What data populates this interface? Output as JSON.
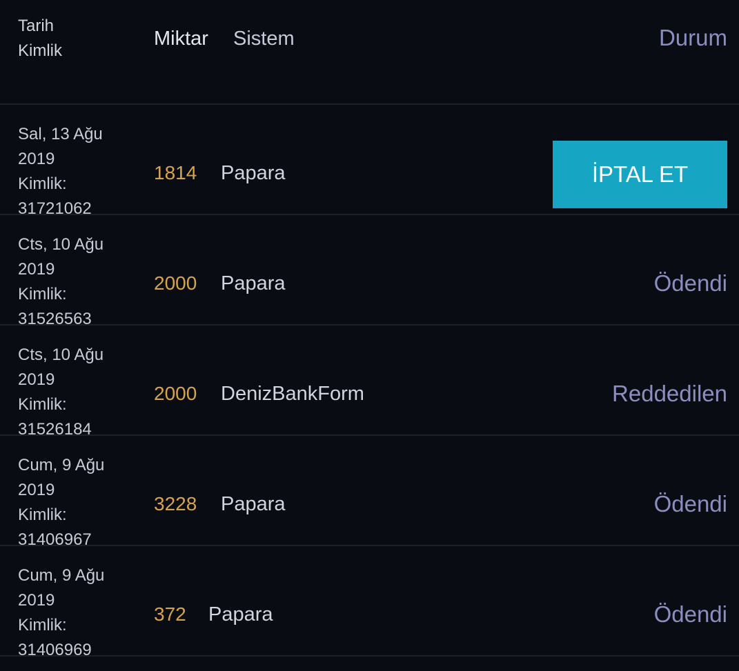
{
  "header": {
    "date_label": "Tarih",
    "id_label": "Kimlik",
    "amount_label": "Miktar",
    "system_label": "Sistem",
    "status_label": "Durum"
  },
  "rows": [
    {
      "date_line1": "Sal, 13 Ağu",
      "date_line2": "2019",
      "id_label": "Kimlik:",
      "id": "31721062",
      "amount": "1814",
      "system": "Papara",
      "action": "İPTAL ET"
    },
    {
      "date_line1": "Cts, 10 Ağu",
      "date_line2": "2019",
      "id_label": "Kimlik:",
      "id": "31526563",
      "amount": "2000",
      "system": "Papara",
      "status": "Ödendi"
    },
    {
      "date_line1": "Cts, 10 Ağu",
      "date_line2": "2019",
      "id_label": "Kimlik:",
      "id": "31526184",
      "amount": "2000",
      "system": "DenizBankForm",
      "status": "Reddedilen"
    },
    {
      "date_line1": "Cum, 9 Ağu",
      "date_line2": "2019",
      "id_label": "Kimlik:",
      "id": "31406967",
      "amount": "3228",
      "system": "Papara",
      "status": "Ödendi"
    },
    {
      "date_line1": "Cum, 9 Ağu",
      "date_line2": "2019",
      "id_label": "Kimlik:",
      "id": "31406969",
      "amount": "372",
      "system": "Papara",
      "status": "Ödendi"
    }
  ],
  "colors": {
    "background": "#0a0c14",
    "amount": "#d6a54a",
    "status": "#8b8fc0",
    "cancel_button": "#16a5c3"
  }
}
